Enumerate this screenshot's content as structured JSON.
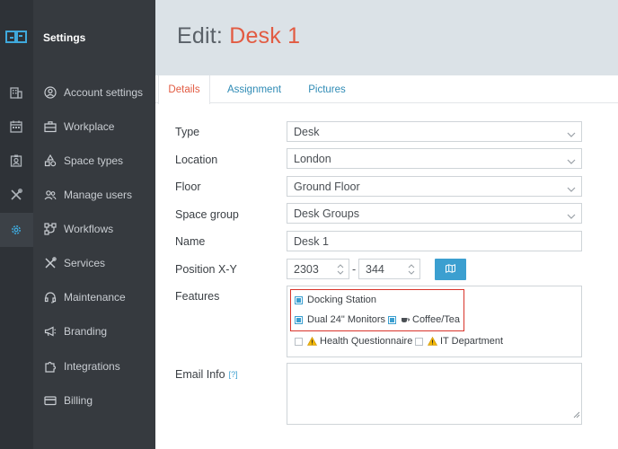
{
  "app": {
    "title": "Settings"
  },
  "sidebar": {
    "items": [
      {
        "label": "Account settings",
        "icon": "user-circle-icon"
      },
      {
        "label": "Workplace",
        "icon": "briefcase-icon"
      },
      {
        "label": "Space types",
        "icon": "shapes-icon"
      },
      {
        "label": "Manage users",
        "icon": "users-icon"
      },
      {
        "label": "Workflows",
        "icon": "workflow-icon"
      },
      {
        "label": "Services",
        "icon": "tools-icon"
      },
      {
        "label": "Maintenance",
        "icon": "headset-icon"
      },
      {
        "label": "Branding",
        "icon": "megaphone-icon"
      },
      {
        "label": "Integrations",
        "icon": "puzzle-icon"
      },
      {
        "label": "Billing",
        "icon": "credit-card-icon"
      }
    ],
    "rail": [
      "building-icon",
      "calendar-icon",
      "badge-icon",
      "tools-icon",
      "gear-icon"
    ]
  },
  "header": {
    "prefix": "Edit:",
    "name": "Desk 1"
  },
  "tabs": [
    {
      "label": "Details",
      "active": true
    },
    {
      "label": "Assignment",
      "active": false
    },
    {
      "label": "Pictures",
      "active": false
    }
  ],
  "form": {
    "type": {
      "label": "Type",
      "value": "Desk"
    },
    "location": {
      "label": "Location",
      "value": "London"
    },
    "floor": {
      "label": "Floor",
      "value": "Ground Floor"
    },
    "space_group": {
      "label": "Space group",
      "value": "Desk Groups"
    },
    "name": {
      "label": "Name",
      "value": "Desk 1"
    },
    "position": {
      "label": "Position X-Y",
      "x": "2303",
      "separator": "-",
      "y": "344"
    },
    "features": {
      "label": "Features",
      "items": [
        {
          "label": "Docking Station",
          "checked": true
        },
        {
          "label": "Dual 24\" Monitors",
          "checked": true
        },
        {
          "label": "Coffee/Tea",
          "checked": true
        },
        {
          "label": "Health Questionnaire",
          "checked": false
        },
        {
          "label": "IT Department",
          "checked": false
        }
      ]
    },
    "email_info": {
      "label": "Email Info",
      "help": "[?]",
      "value": ""
    }
  },
  "colors": {
    "accent": "#e25b42",
    "link": "#2f8bb5",
    "button": "#3b9fd0",
    "highlight": "#d9342b"
  }
}
